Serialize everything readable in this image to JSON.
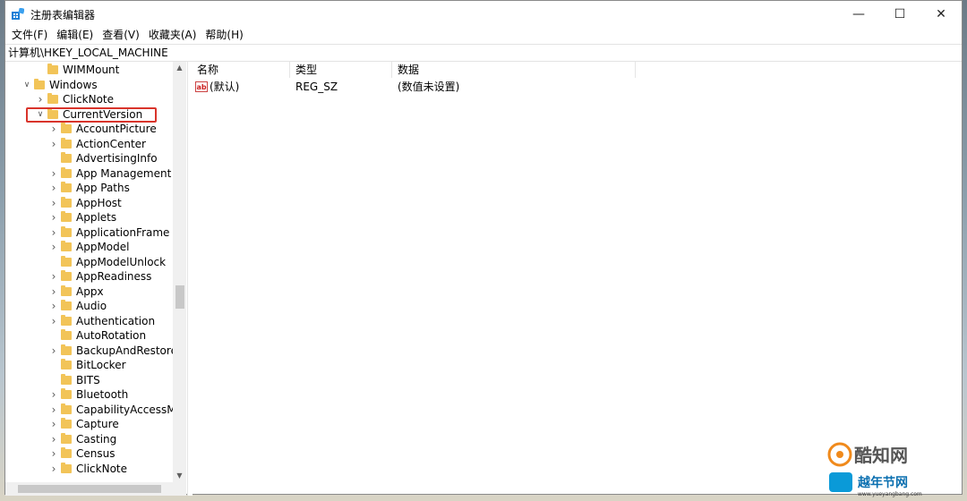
{
  "window": {
    "title": "注册表编辑器",
    "controls": {
      "minimize": "—",
      "maximize": "☐",
      "close": "✕"
    }
  },
  "menu": [
    "文件(F)",
    "编辑(E)",
    "查看(V)",
    "收藏夹(A)",
    "帮助(H)"
  ],
  "address": "计算机\\HKEY_LOCAL_MACHINE",
  "tree": [
    {
      "label": "WIMMount",
      "level": 2,
      "expander": "none"
    },
    {
      "label": "Windows",
      "level": 1,
      "expander": "expanded"
    },
    {
      "label": "ClickNote",
      "level": 2,
      "expander": "collapsed"
    },
    {
      "label": "CurrentVersion",
      "level": 2,
      "expander": "expanded",
      "highlighted": true
    },
    {
      "label": "AccountPicture",
      "level": 3,
      "expander": "collapsed"
    },
    {
      "label": "ActionCenter",
      "level": 3,
      "expander": "collapsed"
    },
    {
      "label": "AdvertisingInfo",
      "level": 3,
      "expander": "none"
    },
    {
      "label": "App Management",
      "level": 3,
      "expander": "collapsed"
    },
    {
      "label": "App Paths",
      "level": 3,
      "expander": "collapsed"
    },
    {
      "label": "AppHost",
      "level": 3,
      "expander": "collapsed"
    },
    {
      "label": "Applets",
      "level": 3,
      "expander": "collapsed"
    },
    {
      "label": "ApplicationFrame",
      "level": 3,
      "expander": "collapsed"
    },
    {
      "label": "AppModel",
      "level": 3,
      "expander": "collapsed"
    },
    {
      "label": "AppModelUnlock",
      "level": 3,
      "expander": "none"
    },
    {
      "label": "AppReadiness",
      "level": 3,
      "expander": "collapsed"
    },
    {
      "label": "Appx",
      "level": 3,
      "expander": "collapsed"
    },
    {
      "label": "Audio",
      "level": 3,
      "expander": "collapsed"
    },
    {
      "label": "Authentication",
      "level": 3,
      "expander": "collapsed"
    },
    {
      "label": "AutoRotation",
      "level": 3,
      "expander": "none"
    },
    {
      "label": "BackupAndRestoreS",
      "level": 3,
      "expander": "collapsed"
    },
    {
      "label": "BitLocker",
      "level": 3,
      "expander": "none"
    },
    {
      "label": "BITS",
      "level": 3,
      "expander": "none"
    },
    {
      "label": "Bluetooth",
      "level": 3,
      "expander": "collapsed"
    },
    {
      "label": "CapabilityAccessMa",
      "level": 3,
      "expander": "collapsed"
    },
    {
      "label": "Capture",
      "level": 3,
      "expander": "collapsed"
    },
    {
      "label": "Casting",
      "level": 3,
      "expander": "collapsed"
    },
    {
      "label": "Census",
      "level": 3,
      "expander": "collapsed"
    },
    {
      "label": "ClickNote",
      "level": 3,
      "expander": "collapsed"
    }
  ],
  "columns": {
    "name": "名称",
    "type": "类型",
    "data": "数据"
  },
  "values": [
    {
      "name": "(默认)",
      "type": "REG_SZ",
      "data": "(数值未设置)",
      "icon": "ab"
    }
  ],
  "colors": {
    "folder": "#f2c458",
    "highlight": "#d9342b",
    "accent": "#0078d7"
  },
  "watermarks": {
    "primary": "酷知网",
    "secondary": "越年节网",
    "url": "www.yueyangbang.com"
  }
}
